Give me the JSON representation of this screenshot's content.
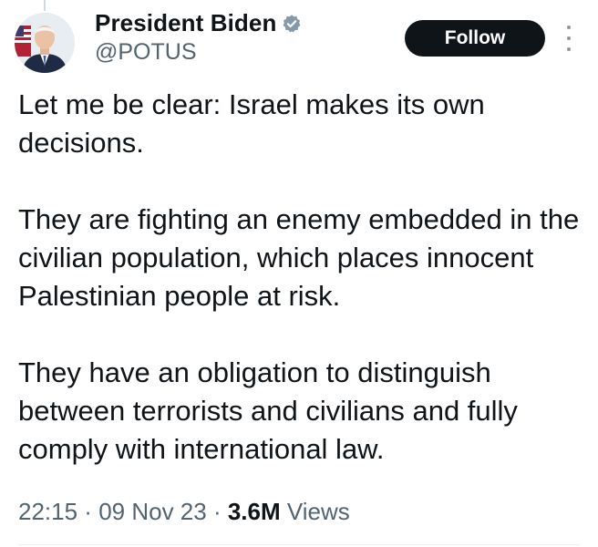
{
  "author": {
    "display_name": "President Biden",
    "handle": "@POTUS",
    "verified_icon": "verified-badge-icon",
    "avatar_icon": "profile-photo"
  },
  "actions": {
    "follow_label": "Follow",
    "more_icon": "more-vertical-icon"
  },
  "tweet": {
    "paragraphs": [
      "Let me be clear: Israel makes its own decisions.",
      "They are fighting an enemy embedded in the civilian population, which places innocent Palestinian people at risk.",
      "They have an obligation to distinguish between terrorists and civilians and fully comply with international law."
    ]
  },
  "meta": {
    "time": "22:15",
    "separator": " · ",
    "date": "09 Nov 23",
    "views_count": "3.6M",
    "views_label": "Views"
  },
  "colors": {
    "text": "#0f1419",
    "secondary": "#536471",
    "follow_bg": "#0f1419",
    "badge": "#829aab"
  }
}
